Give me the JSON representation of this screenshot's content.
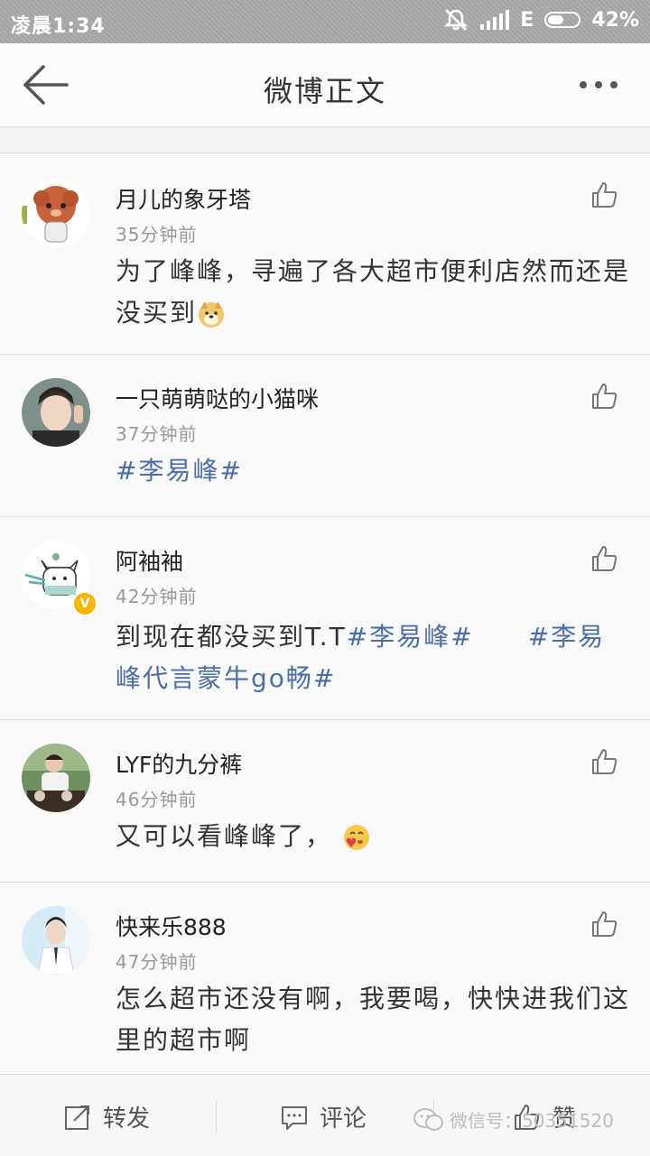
{
  "status_bar": {
    "time": "凌晨1:34",
    "network": "E",
    "battery": "42%",
    "battery_level": 0.42,
    "icons": [
      "mute-icon",
      "signal-icon",
      "battery-icon"
    ]
  },
  "nav": {
    "title": "微博正文",
    "back_icon": "back-arrow-icon",
    "more_icon": "more-dots-icon"
  },
  "comments": [
    {
      "name": "月儿的象牙塔",
      "time": "35分钟前",
      "text_plain": "为了峰峰，寻遍了各大超市便利店然而还是没买到",
      "emoji": "doge-emoji",
      "verified": false
    },
    {
      "name": "一只萌萌哒的小猫咪",
      "time": "37分钟前",
      "tags": [
        "#李易峰#"
      ],
      "verified": false
    },
    {
      "name": "阿袖袖",
      "time": "42分钟前",
      "text_plain": "到现在都没买到T.T",
      "tags": [
        "#李易峰#",
        "#李易峰代言蒙牛go畅#"
      ],
      "verified": true
    },
    {
      "name": "LYF的九分裤",
      "time": "46分钟前",
      "text_plain": "又可以看峰峰了，",
      "emoji": "love-emoji",
      "verified": false
    },
    {
      "name": "快来乐888",
      "time": "47分钟前",
      "text_plain": "怎么超市还没有啊，我要喝，快快进我们这里的超市啊",
      "verified": false
    }
  ],
  "bottom_bar": {
    "repost": "转发",
    "comment": "评论",
    "like": "赞"
  },
  "watermark": "微信号：50351520",
  "colors": {
    "accent_link": "#4a6ea8",
    "verified_badge": "#f7b500",
    "status_bar": "#a9a9a9"
  }
}
